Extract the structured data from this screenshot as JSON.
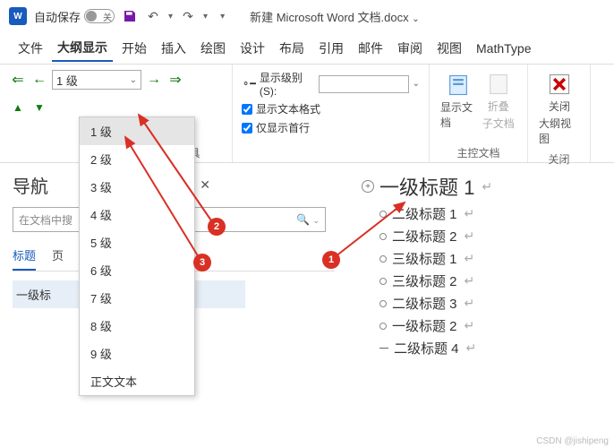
{
  "titlebar": {
    "autosave_label": "自动保存",
    "autosave_state": "关",
    "doc_title": "新建 Microsoft Word 文档.docx"
  },
  "menus": [
    "文件",
    "大纲显示",
    "开始",
    "插入",
    "绘图",
    "设计",
    "布局",
    "引用",
    "邮件",
    "审阅",
    "视图",
    "MathType"
  ],
  "active_menu": 1,
  "ribbon": {
    "level_value": "1 级",
    "show_level_label": "显示级别(S):",
    "show_format": "显示文本格式",
    "first_line_only": "仅显示首行",
    "group_outline": "大纲工具",
    "show_doc": "显示文档",
    "show_doc2": "",
    "collapse_sub": "折叠",
    "collapse_sub2": "子文档",
    "group_master": "主控文档",
    "close1": "关闭",
    "close2": "大纲视图",
    "group_close": "关闭"
  },
  "dropdown_items": [
    "1 级",
    "2 级",
    "3 级",
    "4 级",
    "5 级",
    "6 级",
    "7 级",
    "8 级",
    "9 级",
    "正文文本"
  ],
  "nav": {
    "title": "导航",
    "search_placeholder": "在文档中搜",
    "tabs": [
      "标题",
      "页"
    ],
    "item": "一级标"
  },
  "doc": {
    "h1": "一级标题 1",
    "subs": [
      {
        "text": "二级标题 1",
        "dash": false
      },
      {
        "text": "二级标题 2",
        "dash": false
      },
      {
        "text": "三级标题 1",
        "dash": false
      },
      {
        "text": "三级标题 2",
        "dash": false
      },
      {
        "text": "二级标题 3",
        "dash": false
      },
      {
        "text": "一级标题 2",
        "dash": false
      },
      {
        "text": "二级标题 4",
        "dash": true
      }
    ]
  },
  "annotations": {
    "1": "1",
    "2": "2",
    "3": "3"
  },
  "watermark": "CSDN @jishipeng"
}
